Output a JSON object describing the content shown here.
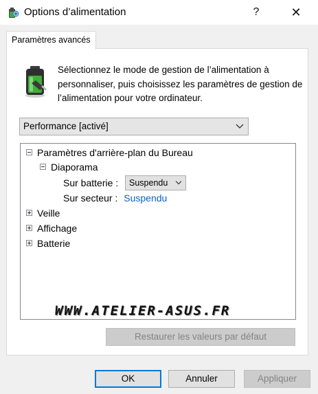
{
  "window": {
    "title": "Options d’alimentation",
    "help_label": "?",
    "close_label": "✕"
  },
  "tab": {
    "label": "Paramètres avancés"
  },
  "description": "Sélectionnez le mode de gestion de l’alimentation à personnaliser, puis choisissez les paramètres de gestion de l’alimentation pour votre ordinateur.",
  "plan_select": {
    "value": "Performance [activé]"
  },
  "tree": {
    "items": [
      {
        "label": "Paramètres d'arrière-plan du Bureau",
        "expanded": true
      },
      {
        "label": "Diaporama",
        "expanded": true
      },
      {
        "label": "Sur batterie :",
        "value": "Suspendu"
      },
      {
        "label": "Sur secteur :",
        "value": "Suspendu"
      },
      {
        "label": "Veille",
        "expanded": false
      },
      {
        "label": "Affichage",
        "expanded": false
      },
      {
        "label": "Batterie",
        "expanded": false
      }
    ]
  },
  "watermark": "WWW.ATELIER-ASUS.FR",
  "buttons": {
    "restore": "Restaurer les valeurs par défaut",
    "ok": "OK",
    "cancel": "Annuler",
    "apply": "Appliquer"
  },
  "colors": {
    "accent": "#0078d7",
    "link": "#0b62c4",
    "battery_green": "#3fae3a"
  },
  "icons": {
    "title": "power-options-icon",
    "battery": "battery-plug-icon"
  }
}
